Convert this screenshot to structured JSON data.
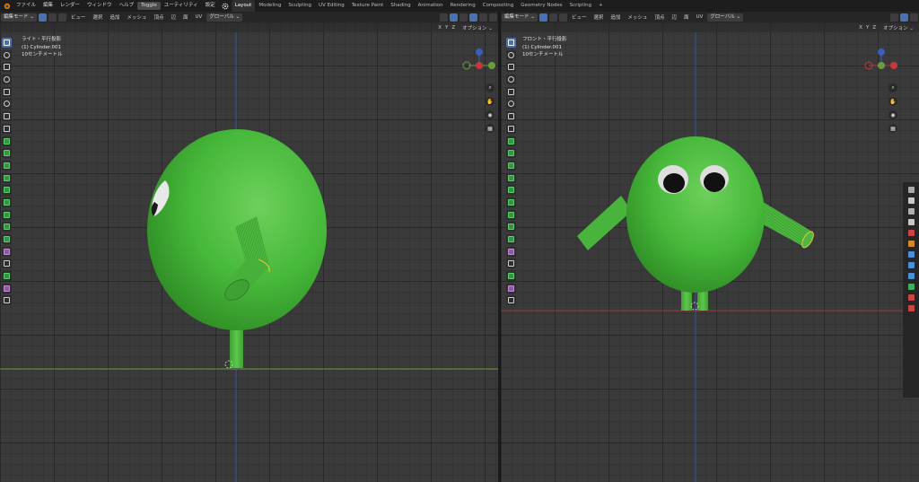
{
  "menu": {
    "items": [
      "ファイル",
      "編集",
      "レンダー",
      "ウィンドウ",
      "ヘルプ"
    ],
    "toggle_label": "Toggle",
    "utility_label": "ユーティリティ",
    "settings_label": "設定"
  },
  "workspaces": [
    "Layout",
    "Modeling",
    "Sculpting",
    "UV Editing",
    "Texture Paint",
    "Shading",
    "Animation",
    "Rendering",
    "Compositing",
    "Geometry Nodes",
    "Scripting"
  ],
  "workspace_add": "+",
  "left_viewport": {
    "mode_label": "編集モード",
    "menus": [
      "ビュー",
      "選択",
      "追加",
      "メッシュ",
      "頂点",
      "辺",
      "面",
      "UV"
    ],
    "orientation_label": "グローバル",
    "axis_labels": [
      "X",
      "Y",
      "Z"
    ],
    "options_label": "オプション",
    "view_name": "ライト・平行投影",
    "object_name": "(1) Cylinder.001",
    "scale_label": "10センチメートル"
  },
  "right_viewport": {
    "mode_label": "編集モード",
    "menus": [
      "ビュー",
      "選択",
      "追加",
      "メッシュ",
      "頂点",
      "辺",
      "面",
      "UV"
    ],
    "orientation_label": "グローバル",
    "axis_labels": [
      "X",
      "Y",
      "Z"
    ],
    "options_label": "オプション",
    "view_name": "フロント・平行投影",
    "object_name": "(1) Cylinder.001",
    "scale_label": "10センチメートル"
  },
  "colors": {
    "character_green": "#46b83a",
    "character_green_light": "#6ed05c",
    "character_green_dark": "#2e8a24",
    "selected_edge": "#e6c43c",
    "axis_x_red": "#c43a3a",
    "axis_y_green": "#6a9e3a",
    "axis_z_blue": "#3a5fb8",
    "active_tool_blue": "#4772b3"
  },
  "icons": [
    "blender-logo-icon",
    "gear-icon",
    "select-box-icon",
    "cursor-icon",
    "move-icon",
    "rotate-icon",
    "scale-icon",
    "transform-icon",
    "annotate-icon",
    "measure-icon",
    "zoom-icon",
    "hand-pan-icon",
    "camera-icon",
    "grid-icon"
  ]
}
